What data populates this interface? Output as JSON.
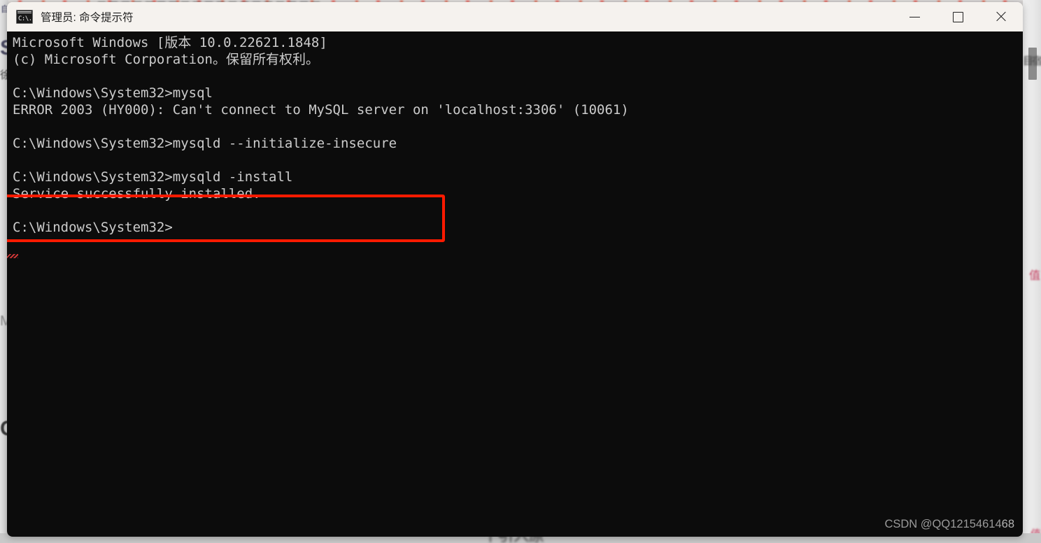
{
  "window": {
    "title": "管理员: 命令提示符",
    "icon": "cmd-icon",
    "icon_text": "C:\\.",
    "controls": {
      "minimize": "—",
      "maximize": "□",
      "close": "✕"
    }
  },
  "console": {
    "background_color": "#0c0c0c",
    "text_color": "#cccccc",
    "lines": "Microsoft Windows [版本 10.0.22621.1848]\n(c) Microsoft Corporation。保留所有权利。\n\nC:\\Windows\\System32>mysql\nERROR 2003 (HY000): Can't connect to MySQL server on 'localhost:3306' (10061)\n\nC:\\Windows\\System32>mysqld --initialize-insecure\n\nC:\\Windows\\System32>mysqld -install\nService successfully installed.\n\nC:\\Windows\\System32>",
    "lines_array": [
      "Microsoft Windows [版本 10.0.22621.1848]",
      "(c) Microsoft Corporation。保留所有权利。",
      "",
      "C:\\Windows\\System32>mysql",
      "ERROR 2003 (HY000): Can't connect to MySQL server on 'localhost:3306' (10061)",
      "",
      "C:\\Windows\\System32>mysqld --initialize-insecure",
      "",
      "C:\\Windows\\System32>mysqld -install",
      "Service successfully installed.",
      "",
      "C:\\Windows\\System32>"
    ],
    "highlight": {
      "color": "#ff1a00",
      "covers": "C:\\Windows\\System32>mysqld -install / Service successfully installed."
    }
  },
  "watermark": {
    "prefix": "CSDN @QQ12154614",
    "suffix": "68"
  },
  "background": {
    "left_labels": {
      "tiny": "自",
      "s": "S",
      "chu": "徐",
      "m": "M",
      "c": "C"
    },
    "right_labels": {
      "top": "目宿",
      "middle": "值",
      "bottom": "值"
    },
    "bottom_text": "个引入原"
  }
}
